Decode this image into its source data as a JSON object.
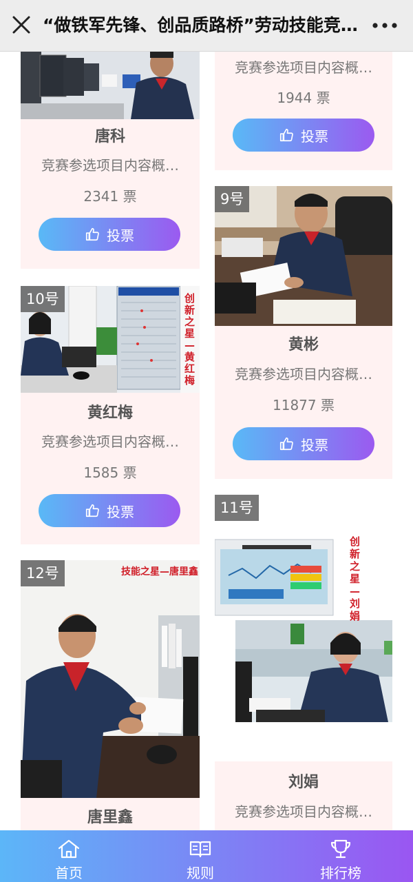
{
  "header": {
    "title": "“做铁军先锋、创品质路桥”劳动技能竞赛…",
    "close_icon": "close-icon",
    "more_icon": "more-icon"
  },
  "cards": {
    "tangke": {
      "name": "唐科",
      "desc": "竞赛参选项目内容概…",
      "votes": "2341 票",
      "vote_label": "投票"
    },
    "top_right": {
      "desc": "竞赛参选项目内容概…",
      "votes": "1944 票",
      "vote_label": "投票"
    },
    "huangbin": {
      "badge": "9号",
      "name": "黄彬",
      "desc": "竞赛参选项目内容概…",
      "votes": "11877 票",
      "vote_label": "投票"
    },
    "huanghongmei": {
      "badge": "10号",
      "name": "黄红梅",
      "desc": "竞赛参选项目内容概…",
      "votes": "1585 票",
      "vote_label": "投票",
      "photo_caption": "创新之星—黄红梅"
    },
    "liujuan": {
      "badge": "11号",
      "name": "刘娟",
      "desc": "竞赛参选项目内容概…",
      "photo_caption": "创新之星—刘娟"
    },
    "tanglixin": {
      "badge": "12号",
      "name": "唐里鑫",
      "photo_caption": "技能之星—唐里鑫"
    }
  },
  "nav": {
    "home": "首页",
    "rules": "规则",
    "ranking": "排行榜"
  },
  "colors": {
    "accent_start": "#59b9f6",
    "accent_end": "#9b5af0",
    "card_bg": "#fff2f2"
  }
}
